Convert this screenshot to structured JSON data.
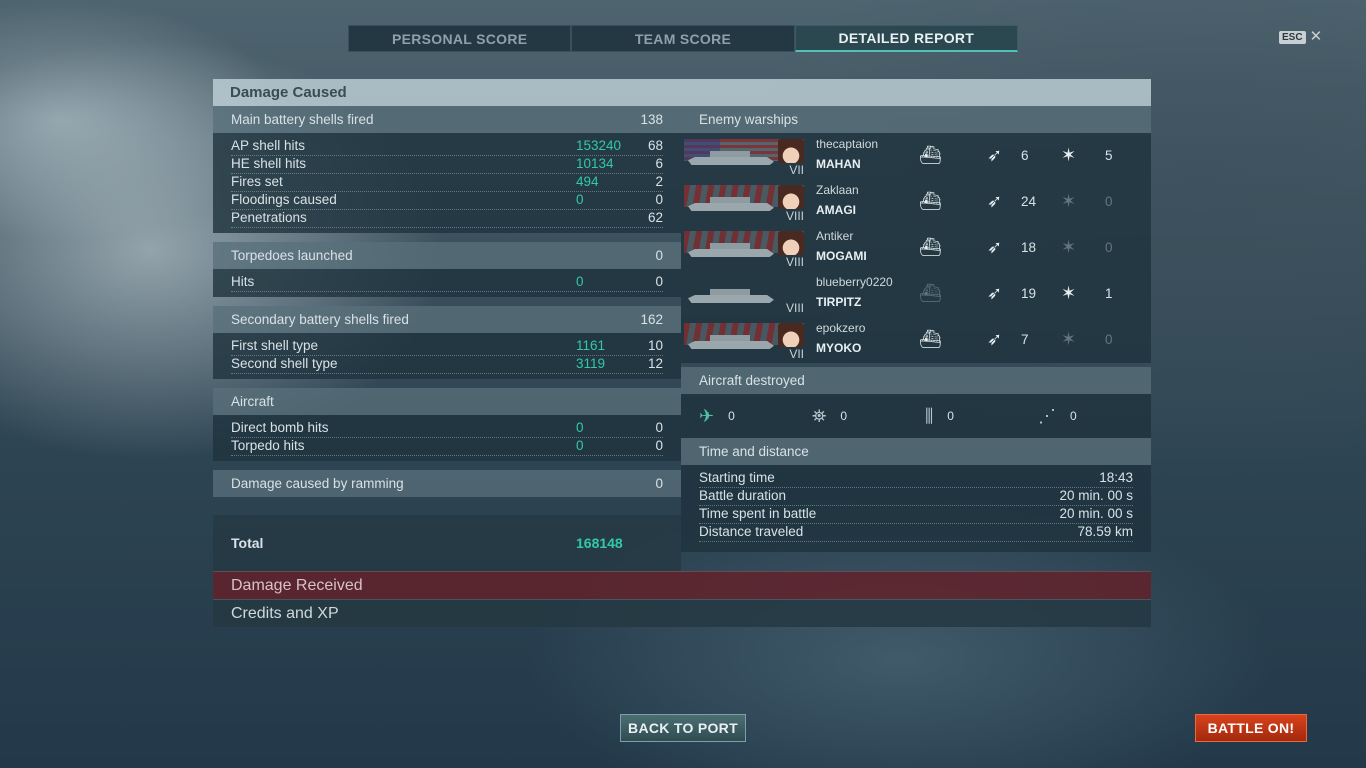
{
  "tabs": [
    {
      "label": "PERSONAL SCORE"
    },
    {
      "label": "TEAM SCORE"
    },
    {
      "label": "DETAILED REPORT"
    }
  ],
  "esc": {
    "key": "ESC",
    "close": "✕"
  },
  "damage_caused": {
    "title": "Damage Caused",
    "main_battery": {
      "label": "Main battery shells fired",
      "value": "138",
      "rows": [
        {
          "label": "AP shell hits",
          "dmg": "153240",
          "count": "68"
        },
        {
          "label": "HE shell hits",
          "dmg": "10134",
          "count": "6"
        },
        {
          "label": "Fires set",
          "dmg": "494",
          "count": "2"
        },
        {
          "label": "Floodings caused",
          "dmg": "0",
          "count": "0"
        },
        {
          "label": "Penetrations",
          "dmg": "",
          "count": "62"
        }
      ]
    },
    "torpedoes": {
      "label": "Torpedoes launched",
      "value": "0",
      "rows": [
        {
          "label": "Hits",
          "dmg": "0",
          "count": "0"
        }
      ]
    },
    "secondary": {
      "label": "Secondary battery shells fired",
      "value": "162",
      "rows": [
        {
          "label": "First shell type",
          "dmg": "1161",
          "count": "10"
        },
        {
          "label": "Second shell type",
          "dmg": "3119",
          "count": "12"
        }
      ]
    },
    "aircraft": {
      "label": "Aircraft",
      "value": "",
      "rows": [
        {
          "label": "Direct bomb hits",
          "dmg": "0",
          "count": "0"
        },
        {
          "label": "Torpedo hits",
          "dmg": "0",
          "count": "0"
        }
      ]
    },
    "ramming": {
      "label": "Damage caused by ramming",
      "value": "0"
    },
    "total": {
      "label": "Total",
      "value": "168148"
    }
  },
  "enemy_warships": {
    "title": "Enemy warships",
    "ships": [
      {
        "player": "thecaptaion",
        "ship": "MAHAN",
        "tier": "VII",
        "flag": "us",
        "sunk_icon": "sunk-icon",
        "sunk_dim": false,
        "hits": "6",
        "hits_dim": false,
        "crit": "5",
        "crit_dim": false
      },
      {
        "player": "Zaklaan",
        "ship": "AMAGI",
        "tier": "VIII",
        "flag": "jp",
        "sunk_icon": "sunk-icon",
        "sunk_dim": false,
        "hits": "24",
        "hits_dim": false,
        "crit": "0",
        "crit_dim": true
      },
      {
        "player": "Antiker",
        "ship": "MOGAMI",
        "tier": "VIII",
        "flag": "jp",
        "sunk_icon": "sunk-icon",
        "sunk_dim": false,
        "hits": "18",
        "hits_dim": false,
        "crit": "0",
        "crit_dim": true
      },
      {
        "player": "blueberry0220",
        "ship": "TIRPITZ",
        "tier": "VIII",
        "flag": "de",
        "sunk_icon": "sunk-icon",
        "sunk_dim": true,
        "hits": "19",
        "hits_dim": false,
        "crit": "1",
        "crit_dim": false
      },
      {
        "player": "epokzero",
        "ship": "MYOKO",
        "tier": "VII",
        "flag": "jp",
        "sunk_icon": "sunk-icon",
        "sunk_dim": false,
        "hits": "7",
        "hits_dim": false,
        "crit": "0",
        "crit_dim": true
      }
    ]
  },
  "aircraft_destroyed": {
    "title": "Aircraft destroyed",
    "items": [
      {
        "icon": "fighter-icon",
        "value": "0"
      },
      {
        "icon": "torpedo-bomber-icon",
        "value": "0"
      },
      {
        "icon": "dive-bomber-icon",
        "value": "0"
      },
      {
        "icon": "scout-icon",
        "value": "0"
      }
    ]
  },
  "time_distance": {
    "title": "Time and distance",
    "rows": [
      {
        "label": "Starting time",
        "value": "18:43"
      },
      {
        "label": "Battle duration",
        "value": "20 min. 00 s"
      },
      {
        "label": "Time spent in battle",
        "value": "20 min. 00 s"
      },
      {
        "label": "Distance traveled",
        "value": "78.59 km"
      }
    ]
  },
  "sections": {
    "damage_received": "Damage Received",
    "credits_xp": "Credits and XP"
  },
  "buttons": {
    "back_to_port": "BACK TO PORT",
    "battle_on": "BATTLE ON!"
  }
}
